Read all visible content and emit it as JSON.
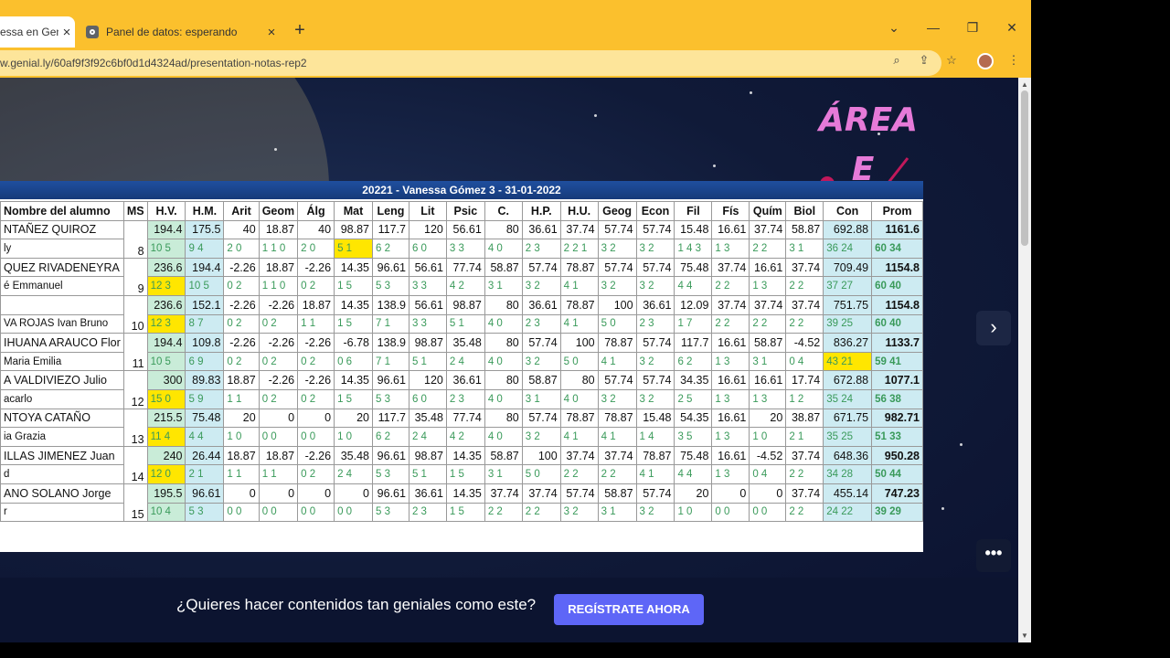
{
  "browser": {
    "tabs": [
      {
        "title": "essa en Gen"
      },
      {
        "title": "Panel de datos: esperando"
      }
    ],
    "url": "w.genial.ly/60af9f3f92c6bf0d1d4324ad/presentation-notas-rep2",
    "icons": [
      "chevron-down-icon",
      "minimize-icon",
      "restore-icon",
      "close-icon",
      "zoom-icon",
      "share-icon",
      "star-icon",
      "kebab-icon"
    ]
  },
  "slide": {
    "area_title": "ÁREA E",
    "banner": "20221 - Vanessa Gómez 3 - 31-01-2022",
    "headers": [
      "Nombre del alumno",
      "MS",
      "H.V.",
      "H.M.",
      "Arit",
      "Geom",
      "Álg",
      "Mat",
      "Leng",
      "Lit",
      "Psic",
      "C.",
      "H.P.",
      "H.U.",
      "Geog",
      "Econ",
      "Fil",
      "Fís",
      "Quím",
      "Biol",
      "Con",
      "Prom"
    ],
    "students": [
      {
        "name1": "NTAÑEZ QUIROZ",
        "name2": "ly",
        "ms": "8",
        "scores": [
          "194.4",
          "175.5",
          "40",
          "18.87",
          "40",
          "98.87",
          "117.7",
          "120",
          "56.61",
          "80",
          "36.61",
          "37.74",
          "57.74",
          "57.74",
          "15.48",
          "16.61",
          "37.74",
          "58.87",
          "692.88",
          "1161.6"
        ],
        "sub": [
          "10 5",
          "9 4",
          "2 0",
          "1 1 0",
          "2 0",
          "5 1",
          "6 2",
          "6 0",
          "3 3",
          "4 0",
          "2 3",
          "2 2 1",
          "3 2",
          "3 2",
          "1 4 3",
          "1 3",
          "2 2",
          "3 1",
          "36 24",
          "60 34"
        ],
        "hl": [
          5
        ]
      },
      {
        "name1": "QUEZ RIVADENEYRA",
        "name2": "é Emmanuel",
        "ms": "9",
        "scores": [
          "236.6",
          "194.4",
          "-2.26",
          "18.87",
          "-2.26",
          "14.35",
          "96.61",
          "56.61",
          "77.74",
          "58.87",
          "57.74",
          "78.87",
          "57.74",
          "57.74",
          "75.48",
          "37.74",
          "16.61",
          "37.74",
          "709.49",
          "1154.8"
        ],
        "sub": [
          "12 3",
          "10 5",
          "0 2",
          "1 1 0",
          "0 2",
          "1 5",
          "5 3",
          "3 3",
          "4 2",
          "3 1",
          "3 2",
          "4 1",
          "3 2",
          "3 2",
          "4 4",
          "2 2",
          "1 3",
          "2 2",
          "37 27",
          "60 40"
        ],
        "hl": [
          0
        ]
      },
      {
        "name1": "",
        "name2": "VA ROJAS Ivan Bruno",
        "ms": "10",
        "scores": [
          "236.6",
          "152.1",
          "-2.26",
          "-2.26",
          "18.87",
          "14.35",
          "138.9",
          "56.61",
          "98.87",
          "80",
          "36.61",
          "78.87",
          "100",
          "36.61",
          "12.09",
          "37.74",
          "37.74",
          "37.74",
          "751.75",
          "1154.8"
        ],
        "sub": [
          "12 3",
          "8 7",
          "0 2",
          "0 2",
          "1 1",
          "1 5",
          "7 1",
          "3 3",
          "5 1",
          "4 0",
          "2 3",
          "4 1",
          "5 0",
          "2 3",
          "1 7",
          "2 2",
          "2 2",
          "2 2",
          "39 25",
          "60 40"
        ],
        "hl": [
          0
        ]
      },
      {
        "name1": "IHUANA ARAUCO Flor",
        "name2": "Maria Emilia",
        "ms": "11",
        "scores": [
          "194.4",
          "109.8",
          "-2.26",
          "-2.26",
          "-2.26",
          "-6.78",
          "138.9",
          "98.87",
          "35.48",
          "80",
          "57.74",
          "100",
          "78.87",
          "57.74",
          "117.7",
          "16.61",
          "58.87",
          "-4.52",
          "836.27",
          "1133.7"
        ],
        "sub": [
          "10 5",
          "6 9",
          "0 2",
          "0 2",
          "0 2",
          "0 6",
          "7 1",
          "5 1",
          "2 4",
          "4 0",
          "3 2",
          "5 0",
          "4 1",
          "3 2",
          "6 2",
          "1 3",
          "3 1",
          "0 4",
          "43 21",
          "59 41"
        ],
        "hl": [
          18
        ]
      },
      {
        "name1": "A VALDIVIEZO Julio",
        "name2": "acarlo",
        "ms": "12",
        "scores": [
          "300",
          "89.83",
          "18.87",
          "-2.26",
          "-2.26",
          "14.35",
          "96.61",
          "120",
          "36.61",
          "80",
          "58.87",
          "80",
          "57.74",
          "57.74",
          "34.35",
          "16.61",
          "16.61",
          "17.74",
          "672.88",
          "1077.1"
        ],
        "sub": [
          "15 0",
          "5 9",
          "1 1",
          "0 2",
          "0 2",
          "1 5",
          "5 3",
          "6 0",
          "2 3",
          "4 0",
          "3 1",
          "4 0",
          "3 2",
          "3 2",
          "2 5",
          "1 3",
          "1 3",
          "1 2",
          "35 24",
          "56 38"
        ],
        "hl": [
          0
        ]
      },
      {
        "name1": "NTOYA CATAÑO",
        "name2": "ia Grazia",
        "ms": "13",
        "scores": [
          "215.5",
          "75.48",
          "20",
          "0",
          "0",
          "20",
          "117.7",
          "35.48",
          "77.74",
          "80",
          "57.74",
          "78.87",
          "78.87",
          "15.48",
          "54.35",
          "16.61",
          "20",
          "38.87",
          "671.75",
          "982.71"
        ],
        "sub": [
          "11 4",
          "4 4",
          "1 0",
          "0 0",
          "0 0",
          "1 0",
          "6 2",
          "2 4",
          "4 2",
          "4 0",
          "3 2",
          "4 1",
          "4 1",
          "1 4",
          "3 5",
          "1 3",
          "1 0",
          "2 1",
          "35 25",
          "51 33"
        ],
        "hl": [
          0
        ]
      },
      {
        "name1": "ILLAS JIMENEZ Juan",
        "name2": "d",
        "ms": "14",
        "scores": [
          "240",
          "26.44",
          "18.87",
          "18.87",
          "-2.26",
          "35.48",
          "96.61",
          "98.87",
          "14.35",
          "58.87",
          "100",
          "37.74",
          "37.74",
          "78.87",
          "75.48",
          "16.61",
          "-4.52",
          "37.74",
          "648.36",
          "950.28"
        ],
        "sub": [
          "12 0",
          "2 1",
          "1 1",
          "1 1",
          "0 2",
          "2 4",
          "5 3",
          "5 1",
          "1 5",
          "3 1",
          "5 0",
          "2 2",
          "2 2",
          "4 1",
          "4 4",
          "1 3",
          "0 4",
          "2 2",
          "34 28",
          "50 44"
        ],
        "hl": [
          0
        ]
      },
      {
        "name1": "ANO SOLANO Jorge",
        "name2": "r",
        "ms": "15",
        "scores": [
          "195.5",
          "96.61",
          "0",
          "0",
          "0",
          "0",
          "96.61",
          "36.61",
          "14.35",
          "37.74",
          "37.74",
          "57.74",
          "58.87",
          "57.74",
          "20",
          "0",
          "0",
          "37.74",
          "455.14",
          "747.23"
        ],
        "sub": [
          "10 4",
          "5 3",
          "0 0",
          "0 0",
          "0 0",
          "0 0",
          "5 3",
          "2 3",
          "1 5",
          "2 2",
          "2 2",
          "3 2",
          "3 1",
          "3 2",
          "1 0",
          "0 0",
          "0 0",
          "2 2",
          "24 22",
          "39 29"
        ],
        "hl": []
      }
    ]
  },
  "cta": {
    "text": "¿Quieres hacer contenidos tan geniales como este?",
    "button": "REGÍSTRATE AHORA"
  }
}
